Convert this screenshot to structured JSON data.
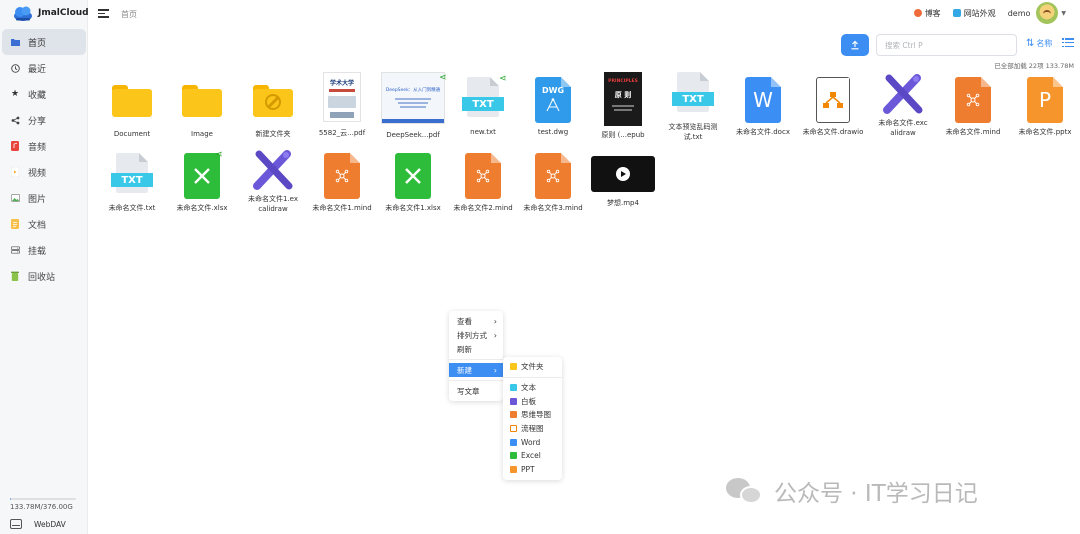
{
  "app": {
    "name": "JmalCloud"
  },
  "breadcrumb": {
    "current": "首页"
  },
  "header": {
    "blog": "博客",
    "site_view": "网站外观",
    "user": "demo"
  },
  "sidebar": {
    "items": [
      {
        "label": "首页",
        "icon": "folder-icon"
      },
      {
        "label": "最近",
        "icon": "clock-icon"
      },
      {
        "label": "收藏",
        "icon": "star-icon"
      },
      {
        "label": "分享",
        "icon": "share-icon"
      },
      {
        "label": "音频",
        "icon": "audio-icon"
      },
      {
        "label": "视频",
        "icon": "video-icon"
      },
      {
        "label": "图片",
        "icon": "image-icon"
      },
      {
        "label": "文档",
        "icon": "document-icon"
      },
      {
        "label": "挂载",
        "icon": "mount-icon"
      },
      {
        "label": "回收站",
        "icon": "trash-icon"
      }
    ],
    "storage": "133.78M/376.00G",
    "storage_used_fraction": 0.0004,
    "webdav": "WebDAV"
  },
  "toolbar": {
    "search_placeholder": "搜索 Ctrl P",
    "sort_label": "名称",
    "loaded_info": "已全部加载 22项 133.78M"
  },
  "files": [
    {
      "name": "Document",
      "type": "folder"
    },
    {
      "name": "Image",
      "type": "folder"
    },
    {
      "name": "新建文件夹",
      "type": "folder-ban"
    },
    {
      "name": "5582_云...pdf",
      "type": "pdf-thumb"
    },
    {
      "name": "DeepSeek...pdf",
      "type": "pdf-thumb-shared"
    },
    {
      "name": "new.txt",
      "type": "txt-shared"
    },
    {
      "name": "test.dwg",
      "type": "dwg"
    },
    {
      "name": "原则 (...epub",
      "type": "epub-thumb"
    },
    {
      "name": "文本预览乱码测试.txt",
      "type": "txt"
    },
    {
      "name": "未命名文件.docx",
      "type": "docx"
    },
    {
      "name": "未命名文件.drawio",
      "type": "drawio"
    },
    {
      "name": "未命名文件.excalidraw",
      "type": "excalidraw"
    },
    {
      "name": "未命名文件.mind",
      "type": "mind"
    },
    {
      "name": "未命名文件.pptx",
      "type": "pptx"
    },
    {
      "name": "未命名文件.txt",
      "type": "txt"
    },
    {
      "name": "未命名文件.xlsx",
      "type": "xlsx-shared"
    },
    {
      "name": "未命名文件1.excalidraw",
      "type": "excalidraw"
    },
    {
      "name": "未命名文件1.mind",
      "type": "mind"
    },
    {
      "name": "未命名文件1.xlsx",
      "type": "xlsx"
    },
    {
      "name": "未命名文件2.mind",
      "type": "mind"
    },
    {
      "name": "未命名文件3.mind",
      "type": "mind"
    },
    {
      "name": "梦想.mp4",
      "type": "video"
    }
  ],
  "file_icon_text": {
    "txt": "TXT",
    "dwg": "DWG",
    "docx": "W",
    "pptx": "P"
  },
  "thumb_text": {
    "pdf_1_title": "学术大学",
    "pdf_2_title": "DeepSeek：从入门到精通",
    "epub_title": "PRINCIPLES",
    "epub_sub": "原 则"
  },
  "context_menu": {
    "view": "查看",
    "sort": "排列方式",
    "refresh": "刷新",
    "new": "新建",
    "write": "写文章"
  },
  "new_submenu": {
    "folder": "文件夹",
    "text": "文本",
    "whiteboard": "白板",
    "mindmap": "思维导图",
    "flowchart": "流程图",
    "word": "Word",
    "excel": "Excel",
    "ppt": "PPT"
  },
  "watermark": {
    "text": "公众号 · IT学习日记"
  },
  "colors": {
    "accent": "#3c8ef3",
    "folder": "#fbc51a",
    "mind": "#ee7d2f",
    "excel": "#2dbd3a",
    "word": "#3b8ef3",
    "excalidraw": "#6b58d8",
    "txt": "#3ac8e8"
  }
}
